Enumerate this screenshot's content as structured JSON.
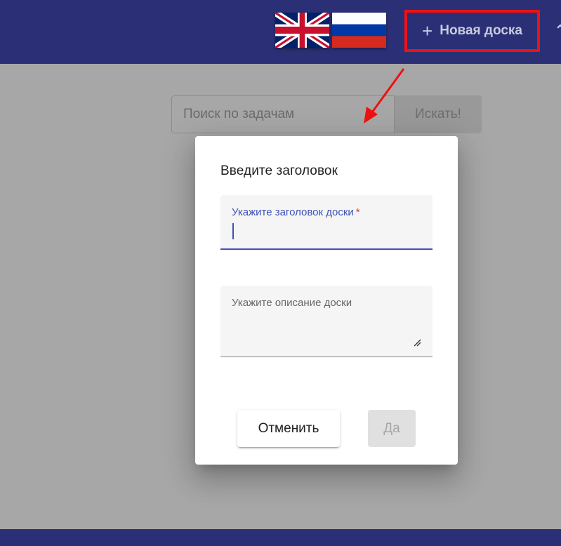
{
  "header": {
    "flags": [
      {
        "name": "uk-flag-icon",
        "language": "English"
      },
      {
        "name": "russia-flag-icon",
        "language": "Русский"
      }
    ],
    "new_board_icon": "plus-icon",
    "new_board_label": "Новая доска"
  },
  "search": {
    "placeholder": "Поиск по задачам",
    "button_label": "Искать!"
  },
  "dialog": {
    "title": "Введите заголовок",
    "title_field": {
      "label": "Укажите заголовок доски",
      "required_mark": "*",
      "value": ""
    },
    "description_field": {
      "label": "Укажите описание доски",
      "value": ""
    },
    "cancel_label": "Отменить",
    "confirm_label": "Да"
  },
  "colors": {
    "header_bg": "#2b3076",
    "accent": "#3f51b5",
    "highlight_box": "#ee1111",
    "overlay": "#a7a7a7"
  }
}
